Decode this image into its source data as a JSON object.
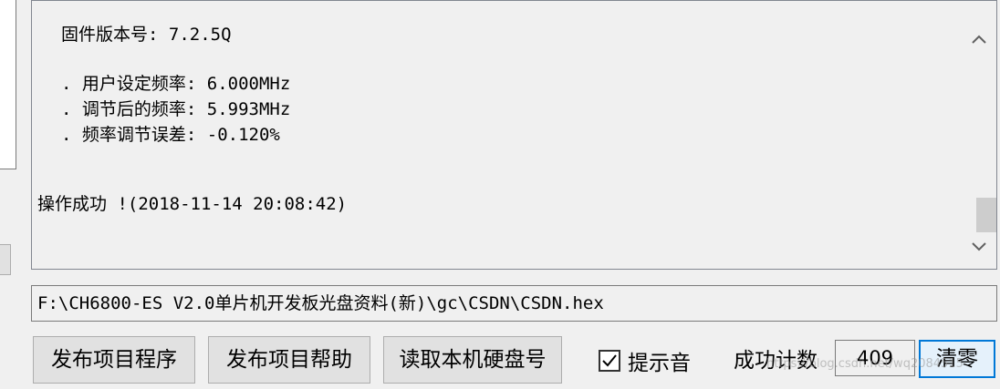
{
  "log": {
    "lines": [
      "固件版本号: 7.2.5Q",
      ". 用户设定频率: 6.000MHz",
      ". 调节后的频率: 5.993MHz",
      ". 频率调节误差: -0.120%",
      "操作成功 !(2018-11-14 20:08:42)"
    ]
  },
  "path": {
    "value": "F:\\CH6800-ES V2.0单片机开发板光盘资料(新)\\gc\\CSDN\\CSDN.hex"
  },
  "buttons": {
    "publish_program": "发布项目程序",
    "publish_help": "发布项目帮助",
    "read_hdd": "读取本机硬盘号",
    "clear": "清零"
  },
  "sound": {
    "label": "提示音",
    "checked": true
  },
  "counter": {
    "label": "成功计数",
    "value": "409"
  },
  "watermark": "https://blog.csdn.net/wq2084515"
}
